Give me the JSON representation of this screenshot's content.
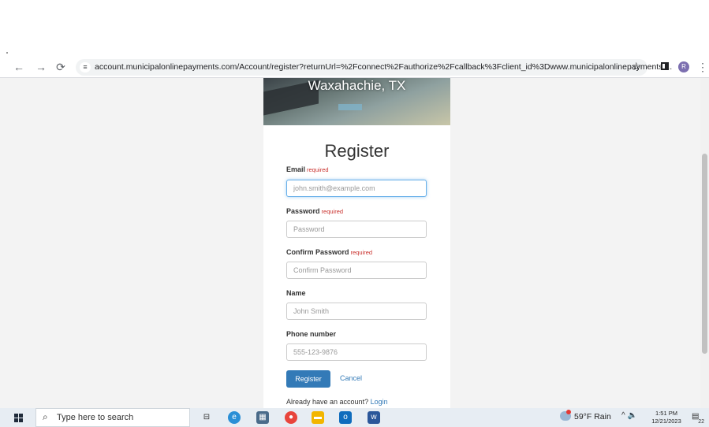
{
  "browser": {
    "back_icon": "arrow-left-icon",
    "forward_icon": "arrow-right-icon",
    "reload_icon": "reload-icon",
    "url": "account.municipalonlinepayments.com/Account/register?returnUrl=%2Fconnect%2Fauthorize%2Fcallback%3Fclient_id%3Dwww.municipalonlinepayments....",
    "profile_initial": "R"
  },
  "page": {
    "banner_title": "Waxahachie, TX",
    "heading": "Register",
    "required_text": "required",
    "fields": {
      "email": {
        "label": "Email",
        "placeholder": "john.smith@example.com",
        "value": ""
      },
      "password": {
        "label": "Password",
        "placeholder": "Password",
        "value": ""
      },
      "confirm_password": {
        "label": "Confirm Password",
        "placeholder": "Confirm Password",
        "value": ""
      },
      "name": {
        "label": "Name",
        "placeholder": "John Smith",
        "value": ""
      },
      "phone": {
        "label": "Phone number",
        "placeholder": "555-123-9876",
        "value": ""
      }
    },
    "register_button": "Register",
    "cancel_link": "Cancel",
    "already_text": "Already have an account?",
    "login_link": "Login",
    "colors": {
      "primary": "#337ab7",
      "required": "#c9302c"
    }
  },
  "taskbar": {
    "search_placeholder": "Type here to search",
    "weather": "59°F Rain",
    "time": "1:51 PM",
    "date": "12/21/2023",
    "notification_count": "22"
  }
}
